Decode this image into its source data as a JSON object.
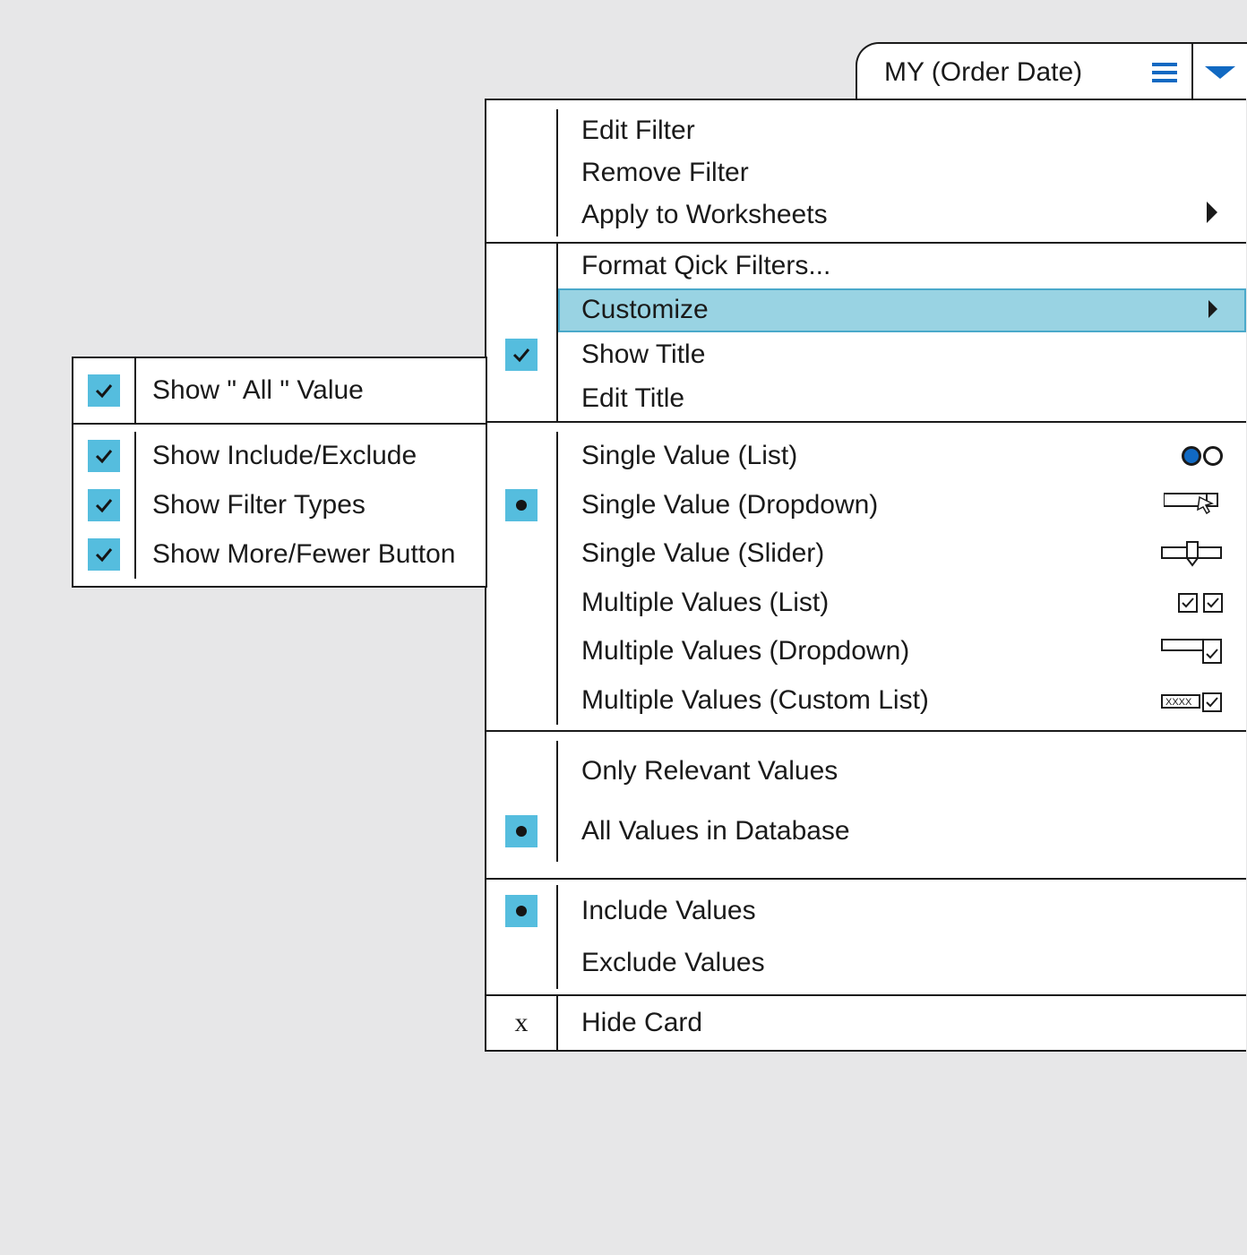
{
  "card": {
    "title": "MY (Order Date)"
  },
  "menu": {
    "section1": [
      {
        "label": "Edit Filter"
      },
      {
        "label": "Remove Filter"
      },
      {
        "label": "Apply to Worksheets",
        "submenu": true
      }
    ],
    "section2": [
      {
        "label": "Format Qick Filters..."
      },
      {
        "label": "Customize",
        "submenu": true,
        "highlight": true
      },
      {
        "label": "Show Title",
        "checked": true
      },
      {
        "label": "Edit Title"
      }
    ],
    "section3": [
      {
        "label": "Single Value  (List)"
      },
      {
        "label": "Single Value  (Dropdown)",
        "selected": true
      },
      {
        "label": "Single Value  (Slider)"
      },
      {
        "label": "Multiple Values (List)"
      },
      {
        "label": "Multiple Values  (Dropdown)"
      },
      {
        "label": "Multiple Values  (Custom List)"
      }
    ],
    "section4": [
      {
        "label": "Only Relevant Values"
      },
      {
        "label": "All Values in Database",
        "selected": true
      }
    ],
    "section5": [
      {
        "label": "Include Values",
        "selected": true
      },
      {
        "label": "Exclude Values"
      }
    ],
    "section6": [
      {
        "label": "Hide Card",
        "x": true
      }
    ]
  },
  "customize": {
    "section1": [
      {
        "label": "Show \" All \" Value",
        "checked": true
      }
    ],
    "section2": [
      {
        "label": "Show Include/Exclude",
        "checked": true
      },
      {
        "label": "Show Filter Types",
        "checked": true
      },
      {
        "label": "Show More/Fewer Button",
        "checked": true
      }
    ]
  }
}
